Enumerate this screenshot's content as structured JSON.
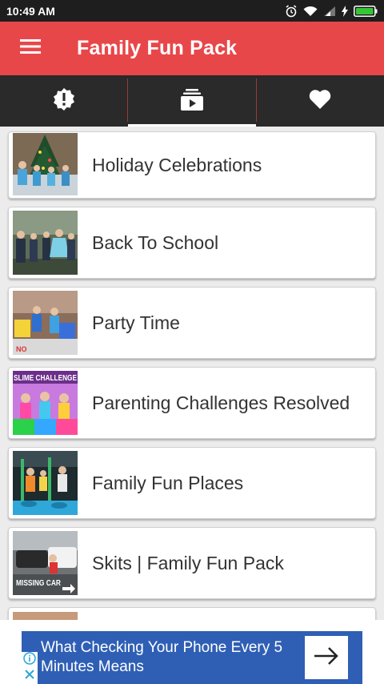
{
  "status_bar": {
    "time": "10:49 AM",
    "icons": [
      "alarm-icon",
      "wifi-icon",
      "signal-icon",
      "charging-icon",
      "battery-icon"
    ]
  },
  "app_bar": {
    "title": "Family Fun Pack",
    "menu_icon": "hamburger-menu-icon",
    "background": "#e8474a"
  },
  "tabs": [
    {
      "icon": "alert-badge-icon",
      "active": false
    },
    {
      "icon": "video-playlist-icon",
      "active": true
    },
    {
      "icon": "heart-icon",
      "active": false
    }
  ],
  "playlists": [
    {
      "label": "Holiday Celebrations"
    },
    {
      "label": "Back To School"
    },
    {
      "label": "Party Time"
    },
    {
      "label": "Parenting Challenges Resolved",
      "thumb_text": "SLIME CHALLENGE"
    },
    {
      "label": "Family Fun Places"
    },
    {
      "label": "Skits | Family Fun Pack",
      "thumb_text": "MISSING CAR"
    }
  ],
  "ad": {
    "text": "What Checking Your Phone Every 5 Minutes Means",
    "background": "#2f5fb5"
  }
}
